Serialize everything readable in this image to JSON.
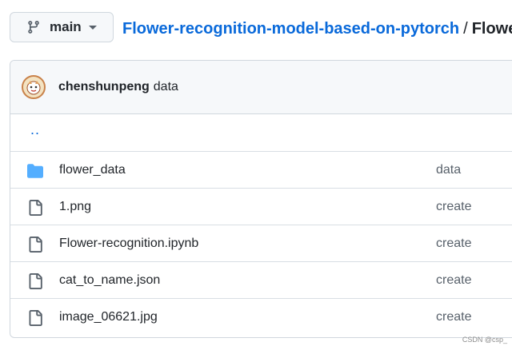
{
  "branch": {
    "name": "main",
    "icon": "git-branch-icon"
  },
  "breadcrumb": {
    "repo": "Flower-recognition-model-based-on-pytorch",
    "separator": "/",
    "current": "Flower"
  },
  "commit": {
    "author": "chenshunpeng",
    "message": "data"
  },
  "parent_link": "..",
  "files": [
    {
      "name": "flower_data",
      "type": "folder",
      "icon": "folder-icon",
      "commit": "data"
    },
    {
      "name": "1.png",
      "type": "file",
      "icon": "file-icon",
      "commit": "create"
    },
    {
      "name": "Flower-recognition.ipynb",
      "type": "file",
      "icon": "file-icon",
      "commit": "create"
    },
    {
      "name": "cat_to_name.json",
      "type": "file",
      "icon": "file-icon",
      "commit": "create"
    },
    {
      "name": "image_06621.jpg",
      "type": "file",
      "icon": "file-icon",
      "commit": "create"
    }
  ],
  "watermark": "CSDN @csp_",
  "colors": {
    "link": "#0969da",
    "folder": "#54aeff",
    "border": "#d0d7de",
    "header_bg": "#f6f8fa"
  }
}
